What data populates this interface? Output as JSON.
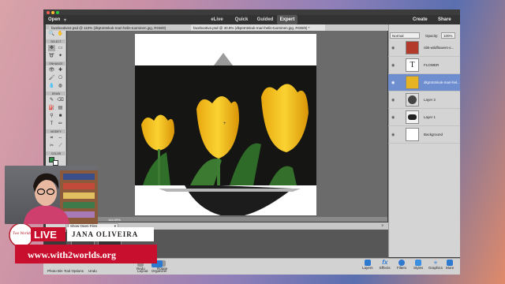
{
  "menubar": {
    "open": "Open",
    "modes": [
      "eLive",
      "Quick",
      "Guided",
      "Expert"
    ],
    "active_mode": "Expert",
    "create": "Create",
    "share": "Share"
  },
  "doc_tabs": [
    "facebootive2.psd @ 110% (dkpt4ntnkuk-mari-helin-tuominen.jpg, RGB/8)",
    "facebootive.psd @ 40.8% (dkpt4ntnkuk-mari-helin-tuominen.jpg, RGB/8) *"
  ],
  "tool_sections": [
    "VIEW",
    "SELECT",
    "ENHANCE",
    "DRAW",
    "MODIFY",
    "COLOR"
  ],
  "zoom_readout": "144.09%",
  "bin": {
    "dropdown": "Show Open Files"
  },
  "layers_panel": {
    "blend_mode": "Normal",
    "opacity_label": "Opacity:",
    "opacity_value": "100%",
    "layers": [
      {
        "name": "nbk-wildflowers-s...",
        "thumb": "#b33a2a"
      },
      {
        "name": "FLOWER",
        "thumb": "#ffffff"
      },
      {
        "name": "dkpt4ntnkuk-mari-hel...",
        "thumb": "#e6b325"
      },
      {
        "name": "Layer 2",
        "thumb": "#444444"
      },
      {
        "name": "Layer 1",
        "thumb": "#f2f2f2"
      },
      {
        "name": "Background",
        "thumb": "#ffffff"
      }
    ]
  },
  "bottom_left": [
    "Photo Bin",
    "Tool Options",
    "Undo",
    "Redo",
    "Rotate",
    "Layout",
    "Organizer"
  ],
  "bottom_right": [
    "Layers",
    "Effects",
    "Filters",
    "Styles",
    "Graphics",
    "More"
  ],
  "overlay": {
    "live": "LIVE",
    "host": "JANA OLIVEIRA",
    "url": "www.with2worlds.org",
    "logo_text": "Two Worlds"
  }
}
